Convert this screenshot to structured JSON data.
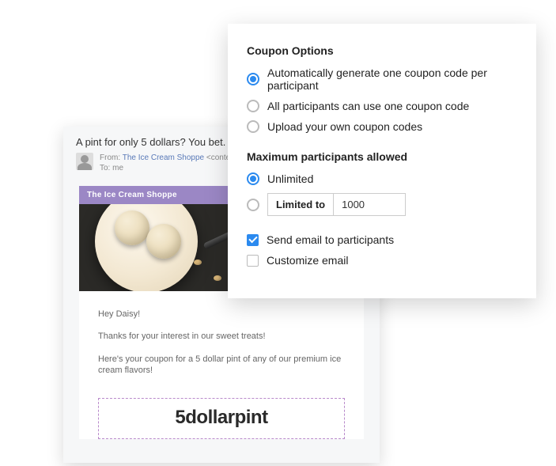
{
  "email": {
    "subject": "A pint for only 5 dollars? You bet.",
    "from_label": "From:",
    "from_name": "The Ice Cream Shoppe",
    "from_email": "<contests@picecream",
    "to_label": "To:",
    "to_value": "me",
    "brand": "The Ice Cream Shoppe",
    "greeting": "Hey Daisy!",
    "line1": "Thanks for your interest in our sweet treats!",
    "line2": "Here's your coupon for a 5 dollar pint of any of our premium ice cream flavors!",
    "coupon_code": "5dollarpint"
  },
  "options": {
    "coupon_section_title": "Coupon Options",
    "coupon_choices": [
      {
        "label": "Automatically generate one coupon code per participant",
        "selected": true
      },
      {
        "label": "All participants can use one coupon code",
        "selected": false
      },
      {
        "label": "Upload your own coupon codes",
        "selected": false
      }
    ],
    "max_section_title": "Maximum participants allowed",
    "max_unlimited_label": "Unlimited",
    "max_unlimited_selected": true,
    "max_limited_prefix": "Limited to",
    "max_limited_value": "1000",
    "send_email_label": "Send email to participants",
    "send_email_checked": true,
    "customize_email_label": "Customize email",
    "customize_email_checked": false
  }
}
